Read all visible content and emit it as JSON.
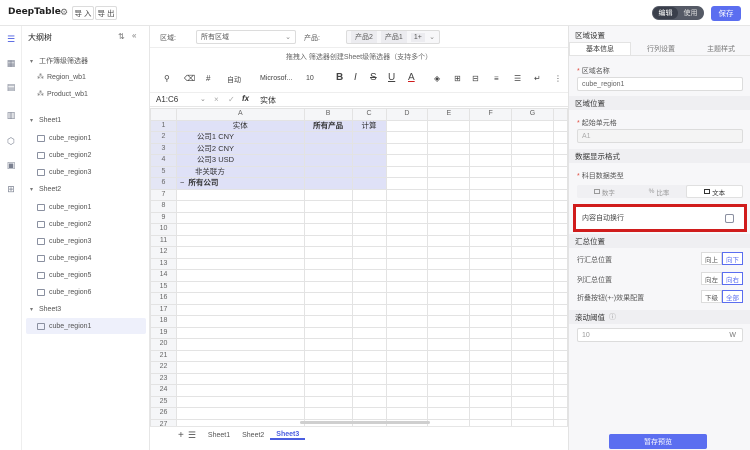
{
  "app": {
    "brand": "DeepTable",
    "import_label": "导 入",
    "export_label": "导 出",
    "mode_edit": "编辑",
    "mode_use": "使用",
    "save_label": "保存"
  },
  "tree": {
    "title": "大纲树",
    "groups": [
      {
        "label": "工作簿级筛选器",
        "items": [
          "Region_wb1",
          "Product_wb1"
        ]
      },
      {
        "label": "Sheet1",
        "items": [
          "cube_region1",
          "cube_region2",
          "cube_region3"
        ]
      },
      {
        "label": "Sheet2",
        "items": [
          "cube_region1",
          "cube_region2",
          "cube_region3",
          "cube_region4",
          "cube_region5",
          "cube_region6"
        ]
      },
      {
        "label": "Sheet3",
        "items": [
          "cube_region1"
        ]
      }
    ]
  },
  "filters": {
    "region_label": "区域:",
    "region_value": "所有区域",
    "product_label": "产品:",
    "product_chips": [
      "产品2",
      "产品1",
      "1+"
    ]
  },
  "hint": "拖拽入 筛选器创建Sheet级筛选器（支持多个）",
  "toolbar": {
    "auto": "自动",
    "font": "Microsof...",
    "size": "10"
  },
  "formula": {
    "cell_ref": "A1:C6",
    "fx": "fx",
    "value": "实体"
  },
  "sheet": {
    "columns": [
      "A",
      "B",
      "C",
      "D",
      "E",
      "F",
      "G"
    ],
    "header_row": [
      "实体",
      "所有产品",
      "计算"
    ],
    "rows": [
      "公司1 CNY",
      "公司2 CNY",
      "公司3 USD",
      "非关联方",
      "所有公司"
    ],
    "row_count": 27
  },
  "sheet_tabs": [
    "Sheet1",
    "Sheet2",
    "Sheet3"
  ],
  "panel": {
    "header": "区域设置",
    "tabs": [
      "基本信息",
      "行列设置",
      "主题样式"
    ],
    "name_label": "区域名称",
    "name_value": "cube_region1",
    "position_section": "区域位置",
    "start_cell_label": "起始单元格",
    "start_cell_value": "A1",
    "format_section": "数据显示格式",
    "type_label": "科目数据类型",
    "type_options": [
      "数字",
      "比率",
      "文本"
    ],
    "wrap_label": "内容自动换行",
    "summary_section": "汇总位置",
    "row_summary_label": "行汇总位置",
    "row_summary_opts": [
      "向上",
      "向下"
    ],
    "col_summary_label": "列汇总位置",
    "col_summary_opts": [
      "向左",
      "向右"
    ],
    "collapse_label": "折叠按钮(+-)效果配置",
    "collapse_opts": [
      "下级",
      "全部"
    ],
    "threshold_section": "滚动阈值",
    "threshold_value": "10",
    "threshold_unit": "W",
    "save_preview": "暂存预览"
  }
}
